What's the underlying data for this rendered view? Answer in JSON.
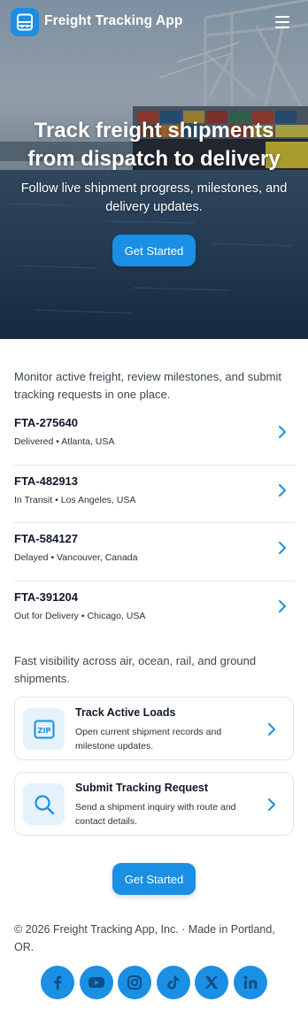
{
  "header": {
    "app_title": "Freight Tracking App",
    "logo_icon": "truck-window-icon",
    "menu_icon": "hamburger-menu-icon"
  },
  "hero": {
    "title": "Track freight shipments from dispatch to delivery",
    "subtitle": "Follow live shipment progress, milestones, and delivery updates.",
    "cta_label": "Get Started"
  },
  "intro": {
    "text": "Monitor active freight, review milestones, and submit tracking requests in one place."
  },
  "shipments": [
    {
      "id": "FTA-275640",
      "status": "Delivered",
      "location": "Atlanta, USA",
      "meta": "Delivered • Atlanta, USA"
    },
    {
      "id": "FTA-482913",
      "status": "In Transit",
      "location": "Los Angeles, USA",
      "meta": "In Transit • Los Angeles, USA"
    },
    {
      "id": "FTA-584127",
      "status": "Delayed",
      "location": "Vancouver, Canada",
      "meta": "Delayed • Vancouver, Canada"
    },
    {
      "id": "FTA-391204",
      "status": "Out for Delivery",
      "location": "Chicago, USA",
      "meta": "Out for Delivery • Chicago, USA"
    }
  ],
  "tagline": {
    "text": "Fast visibility across air, ocean, rail, and ground shipments."
  },
  "cards": [
    {
      "title": "Track Active Loads",
      "description": "Open current shipment records and milestone updates.",
      "icon": "zip-icon"
    },
    {
      "title": "Submit Tracking Request",
      "description": "Send a shipment inquiry with route and contact details.",
      "icon": "search-icon"
    }
  ],
  "bottom_cta": {
    "label": "Get Started"
  },
  "footer": {
    "text": "© 2026 Freight Tracking App, Inc. · Made in Portland, OR."
  },
  "socials": [
    {
      "name": "facebook",
      "icon": "facebook-icon"
    },
    {
      "name": "youtube",
      "icon": "youtube-icon"
    },
    {
      "name": "instagram",
      "icon": "instagram-icon"
    },
    {
      "name": "tiktok",
      "icon": "tiktok-icon"
    },
    {
      "name": "x",
      "icon": "x-icon"
    },
    {
      "name": "linkedin",
      "icon": "linkedin-icon"
    }
  ],
  "colors": {
    "accent": "#1a8fe3",
    "icon_tile": "#e6f2fb",
    "text_dark": "#111827",
    "text_body": "#3d4650",
    "divider": "#e4e7eb"
  }
}
